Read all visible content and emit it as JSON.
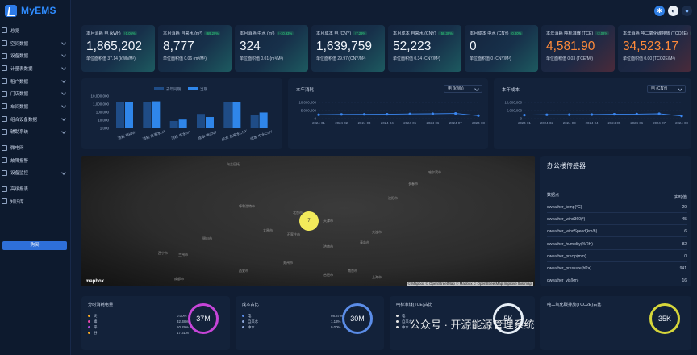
{
  "app": {
    "title": "MyEMS"
  },
  "sidebar": {
    "items": [
      {
        "label": "总览",
        "chev": false
      },
      {
        "label": "空间数据",
        "chev": true
      },
      {
        "label": "设备数据",
        "chev": true
      },
      {
        "label": "计量表数据",
        "chev": true
      },
      {
        "label": "租户数据",
        "chev": true
      },
      {
        "label": "门店数据",
        "chev": true
      },
      {
        "label": "车间数据",
        "chev": true
      },
      {
        "label": "组合设备数据",
        "chev": true
      },
      {
        "label": "辅助系统",
        "chev": true
      },
      {
        "label": "微电网",
        "chev": false
      },
      {
        "label": "故障报警",
        "chev": false
      },
      {
        "label": "设备监控",
        "chev": true
      },
      {
        "label": "高级报表",
        "chev": false
      },
      {
        "label": "知识库",
        "chev": false
      }
    ],
    "buy_label": "购买"
  },
  "kpis": [
    {
      "title": "本月消耗 电 (kWh)",
      "badge": "↑0.05%",
      "value": "1,865,202",
      "sub": "单位面积值 37.14 (kWh/M²)",
      "orange": false,
      "pink": false
    },
    {
      "title": "本月消耗 自来水 (m³)",
      "badge": "↑69.29%",
      "value": "8,777",
      "sub": "单位面积值 0.06 (m³/M²)",
      "orange": false,
      "pink": false
    },
    {
      "title": "本月消耗 中水 (m³)",
      "badge": "↑-10.93%",
      "value": "324",
      "sub": "单位面积值 0.01 (m³/M²)",
      "orange": false,
      "pink": false
    },
    {
      "title": "本月成本 电 (CNY)",
      "badge": "↑7.29%",
      "value": "1,639,759",
      "sub": "单位面积值 29.97 (CNY/M²)",
      "orange": false,
      "pink": false
    },
    {
      "title": "本月成本 自来水 (CNY)",
      "badge": "↑58.39%",
      "value": "52,223",
      "sub": "单位面积值 0.34 (CNY/M²)",
      "orange": false,
      "pink": false
    },
    {
      "title": "本月成本 中水 (CNY)",
      "badge": "0.00%",
      "value": "0",
      "sub": "单位面积值 0 (CNY/M²)",
      "orange": false,
      "pink": false
    },
    {
      "title": "本年消耗 吨标准煤 (TCE)",
      "badge": "↑2.02%",
      "value": "4,581.90",
      "sub": "单位面积值 0.03 (TCE/M²)",
      "orange": true,
      "pink": true
    },
    {
      "title": "本年消耗 吨二氧化碳排放 (TCO2E)",
      "badge": "↑2.02%",
      "value": "34,523.17",
      "sub": "单位面积值 0.00 (TCO2E/M²)",
      "orange": true,
      "pink": true
    }
  ],
  "bar_panel": {
    "legend": [
      "去年同期",
      "当期"
    ]
  },
  "line1": {
    "title": "本年消耗",
    "select": "电 (kWh)"
  },
  "line2": {
    "title": "本年成本",
    "select": "电 (CNY)"
  },
  "chart_data": [
    {
      "type": "bar",
      "title": "",
      "legend": [
        "去年同期",
        "当期"
      ],
      "categories": [
        "消耗 电kWh",
        "消耗 自来水m³",
        "消耗 中水m³",
        "成本 电CNY",
        "成本 自来水CNY",
        "成本 中水CNY"
      ],
      "yscale": "log",
      "yticks": [
        "10,000,000",
        "1,000,000",
        "100,000",
        "10,000",
        "1,000"
      ],
      "ylim": [
        1000,
        10000000
      ],
      "series": [
        {
          "name": "去年同期",
          "values": [
            1750000,
            2000000,
            8000,
            60000,
            1600000,
            45000
          ]
        },
        {
          "name": "当期",
          "values": [
            1865202,
            2200000,
            12000,
            25000,
            1639759,
            90000
          ]
        }
      ]
    },
    {
      "type": "line",
      "title": "本年消耗",
      "categories": [
        "2024-01",
        "2024-02",
        "2024-03",
        "2024-04",
        "2024-05",
        "2024-06",
        "2024-07",
        "2024-08"
      ],
      "yticks": [
        "10,000,000",
        "5,000,000",
        "0"
      ],
      "ylim": [
        0,
        10000000
      ],
      "series": [
        {
          "values": [
            2400000,
            2600000,
            2650000,
            2700000,
            2900000,
            3000000,
            3200000,
            1865202
          ]
        }
      ]
    },
    {
      "type": "line",
      "title": "本年成本",
      "categories": [
        "2024-01",
        "2024-02",
        "2024-03",
        "2024-04",
        "2024-05",
        "2024-06",
        "2024-07",
        "2024-08"
      ],
      "yticks": [
        "10,000,000",
        "5,000,000",
        "0"
      ],
      "ylim": [
        0,
        10000000
      ],
      "series": [
        {
          "values": [
            2200000,
            2400000,
            2450000,
            2500000,
            2700000,
            2800000,
            3000000,
            1639759
          ]
        }
      ]
    }
  ],
  "map": {
    "cities": [
      "哈尔滨市",
      "长春市",
      "沈阳市",
      "大连市",
      "北京市",
      "天津市",
      "石家庄市",
      "太原市",
      "济南市",
      "呼和浩特市",
      "银川市",
      "兰州市",
      "西宁市",
      "郑州市",
      "西安市",
      "青岛市",
      "南京市",
      "合肥市",
      "武汉市",
      "上海市",
      "杭州市",
      "成都市",
      "重庆市",
      "長沙市",
      "乌兰巴托"
    ],
    "marker": "7",
    "attribution": "© Mapbox © OpenStreetMap © Mapbox © OpenStreetMap Improve this map",
    "logo": "mapbox"
  },
  "sensor": {
    "title": "办公楼传感器",
    "header": {
      "name": "数据点",
      "value": "实时值"
    },
    "rows": [
      {
        "name": "qweather_temp(°C)",
        "value": "29"
      },
      {
        "name": "qweather_wind360(°)",
        "value": "45"
      },
      {
        "name": "qweather_windSpeed(km/h)",
        "value": "6"
      },
      {
        "name": "qweather_humidity(%RH)",
        "value": "82"
      },
      {
        "name": "qweather_precip(mm)",
        "value": "0"
      },
      {
        "name": "qweather_pressure(hPa)",
        "value": "941"
      },
      {
        "name": "qweather_vis(km)",
        "value": "16"
      }
    ]
  },
  "bottom": [
    {
      "title": "分时消耗电量",
      "legend": [
        {
          "name": "尖",
          "value": "0.00%",
          "color": "#f5a623"
        },
        {
          "name": "峰",
          "value": "32.38%",
          "color": "#e845a8"
        },
        {
          "name": "平",
          "value": "50.29%",
          "color": "#b04bd8"
        },
        {
          "name": "谷",
          "value": "17.61%",
          "color": "#f5a623"
        }
      ],
      "ring": "37M",
      "ring_color": "#c645d8"
    },
    {
      "title": "成本占比",
      "legend": [
        {
          "name": "电",
          "value": "98.87%",
          "color": "#5b8de8"
        },
        {
          "name": "自来水",
          "value": "1.13%",
          "color": "#8da6d8"
        },
        {
          "name": "中水",
          "value": "0.00%",
          "color": "#8da6d8"
        }
      ],
      "ring": "30M",
      "ring_color": "#5b8de8"
    },
    {
      "title": "吨标准煤(TCE)占比",
      "legend": [
        {
          "name": "电",
          "value": "",
          "color": "#e6e6e6"
        },
        {
          "name": "自来水",
          "value": "",
          "color": "#e6e6e6"
        },
        {
          "name": "中水",
          "value": "",
          "color": "#e6e6e6"
        }
      ],
      "ring": "5K",
      "ring_color": "#e6eef6"
    },
    {
      "title": "吨二氧化碳排放(TCO2E)占比",
      "legend": [],
      "ring": "35K",
      "ring_color": "#d6d63a"
    }
  ],
  "watermark": "公众号 · 开源能源管理系统"
}
